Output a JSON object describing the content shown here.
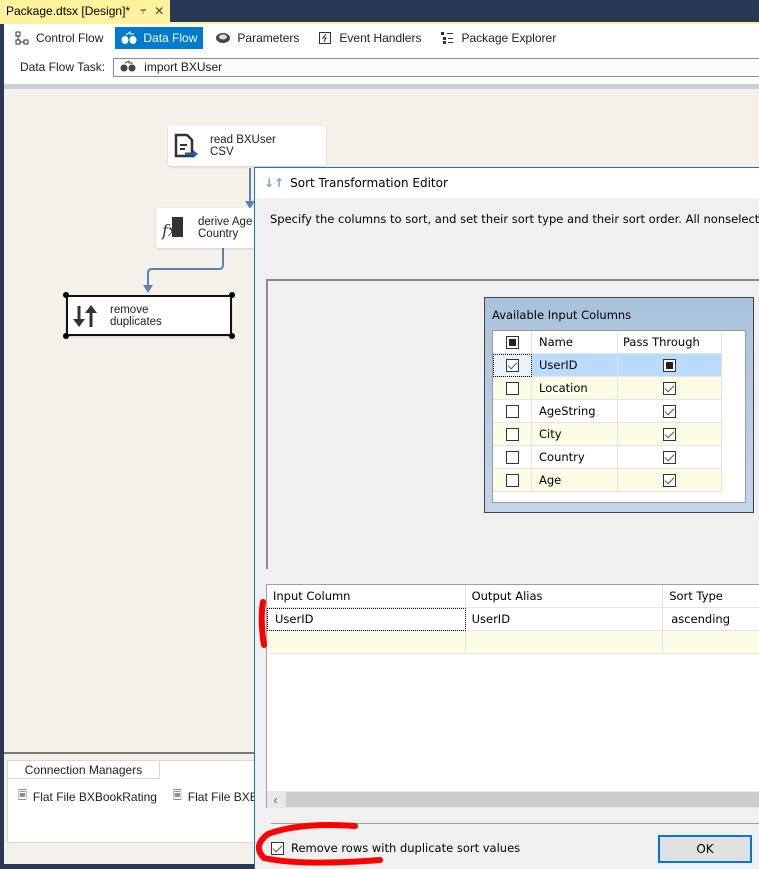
{
  "document_tab": {
    "title": "Package.dtsx [Design]*",
    "pin_icon": "pin-icon",
    "close_icon": "close-icon"
  },
  "designer_tabs": [
    {
      "label": "Control Flow",
      "icon": "control-flow-icon",
      "active": false
    },
    {
      "label": "Data Flow",
      "icon": "data-flow-icon",
      "active": true
    },
    {
      "label": "Parameters",
      "icon": "parameters-icon",
      "active": false
    },
    {
      "label": "Event Handlers",
      "icon": "event-handlers-icon",
      "active": false
    },
    {
      "label": "Package Explorer",
      "icon": "package-explorer-icon",
      "active": false
    }
  ],
  "data_flow_task": {
    "label": "Data Flow Task:",
    "value": "import BXUser"
  },
  "components": [
    {
      "line1": "read BXUser",
      "line2": "CSV",
      "icon": "flat-file-source-icon"
    },
    {
      "line1": "derive Age",
      "line2": "Country",
      "icon": "derived-column-icon"
    },
    {
      "line1": "remove",
      "line2": "duplicates",
      "icon": "sort-icon",
      "selected": true
    }
  ],
  "connection_managers": {
    "tab_label": "Connection Managers",
    "items": [
      "Flat File BXBookRating",
      "Flat File BXBoo"
    ]
  },
  "dialog": {
    "title": "Sort Transformation Editor",
    "description": "Specify the columns to sort, and set their sort type and their sort order. All nonselected colum",
    "available_columns": {
      "title": "Available Input Columns",
      "headers": [
        "Name",
        "Pass Through"
      ],
      "header_checkbox": "indeterminate",
      "rows": [
        {
          "name": "UserID",
          "selected": "checked",
          "pass_through": "indeterminate"
        },
        {
          "name": "Location",
          "selected": "unchecked",
          "pass_through": "checked"
        },
        {
          "name": "AgeString",
          "selected": "unchecked",
          "pass_through": "checked"
        },
        {
          "name": "City",
          "selected": "unchecked",
          "pass_through": "checked"
        },
        {
          "name": "Country",
          "selected": "unchecked",
          "pass_through": "checked"
        },
        {
          "name": "Age",
          "selected": "unchecked",
          "pass_through": "checked"
        }
      ]
    },
    "sort_grid": {
      "headers": [
        "Input Column",
        "Output Alias",
        "Sort Type"
      ],
      "rows": [
        {
          "input_column": "UserID",
          "output_alias": "UserID",
          "sort_type": "ascending"
        }
      ]
    },
    "remove_duplicates": {
      "label": "Remove rows with duplicate sort values",
      "checked": true
    },
    "ok_label": "OK"
  }
}
